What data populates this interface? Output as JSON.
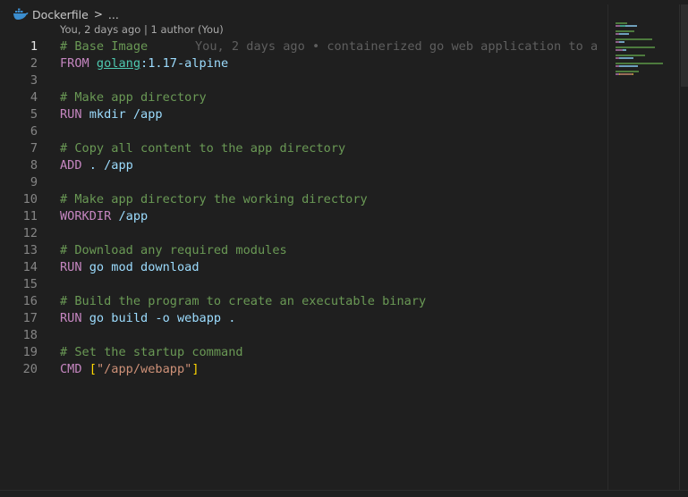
{
  "breadcrumb": {
    "file_icon": "docker-whale-icon",
    "file_name": "Dockerfile",
    "separator": ">",
    "ellipsis": "..."
  },
  "codelens": {
    "text": "You, 2 days ago | 1 author (You)"
  },
  "blame": {
    "text": "You, 2 days ago • containerized go web application to a"
  },
  "colors": {
    "background": "#1f1f1f",
    "comment": "#6a9955",
    "keyword": "#c586c0",
    "identifier": "#9cdcfe",
    "string": "#ce9178",
    "bracket": "#ffd700",
    "line_number": "#858585"
  },
  "lines": [
    {
      "n": "1",
      "tokens": [
        [
          "comment",
          "# Base Image"
        ]
      ]
    },
    {
      "n": "2",
      "tokens": [
        [
          "keyword",
          "FROM "
        ],
        [
          "image",
          "golang"
        ],
        [
          "ident",
          ":1.17-alpine"
        ]
      ]
    },
    {
      "n": "3",
      "tokens": []
    },
    {
      "n": "4",
      "tokens": [
        [
          "comment",
          "# Make app directory"
        ]
      ]
    },
    {
      "n": "5",
      "tokens": [
        [
          "keyword",
          "RUN "
        ],
        [
          "ident",
          "mkdir /app"
        ]
      ]
    },
    {
      "n": "6",
      "tokens": []
    },
    {
      "n": "7",
      "tokens": [
        [
          "comment",
          "# Copy all content to the app directory"
        ]
      ]
    },
    {
      "n": "8",
      "tokens": [
        [
          "keyword",
          "ADD "
        ],
        [
          "ident",
          ". /app"
        ]
      ]
    },
    {
      "n": "9",
      "tokens": []
    },
    {
      "n": "10",
      "tokens": [
        [
          "comment",
          "# Make app directory the working directory"
        ]
      ]
    },
    {
      "n": "11",
      "tokens": [
        [
          "keyword",
          "WORKDIR "
        ],
        [
          "ident",
          "/app"
        ]
      ]
    },
    {
      "n": "12",
      "tokens": []
    },
    {
      "n": "13",
      "tokens": [
        [
          "comment",
          "# Download any required modules"
        ]
      ]
    },
    {
      "n": "14",
      "tokens": [
        [
          "keyword",
          "RUN "
        ],
        [
          "ident",
          "go mod download"
        ]
      ]
    },
    {
      "n": "15",
      "tokens": []
    },
    {
      "n": "16",
      "tokens": [
        [
          "comment",
          "# Build the program to create an executable binary"
        ]
      ]
    },
    {
      "n": "17",
      "tokens": [
        [
          "keyword",
          "RUN "
        ],
        [
          "ident",
          "go build -o webapp ."
        ]
      ]
    },
    {
      "n": "18",
      "tokens": []
    },
    {
      "n": "19",
      "tokens": [
        [
          "comment",
          "# Set the startup command"
        ]
      ]
    },
    {
      "n": "20",
      "tokens": [
        [
          "keyword",
          "CMD "
        ],
        [
          "bracket",
          "["
        ],
        [
          "string",
          "\"/app/webapp\""
        ],
        [
          "bracket",
          "]"
        ]
      ]
    }
  ]
}
